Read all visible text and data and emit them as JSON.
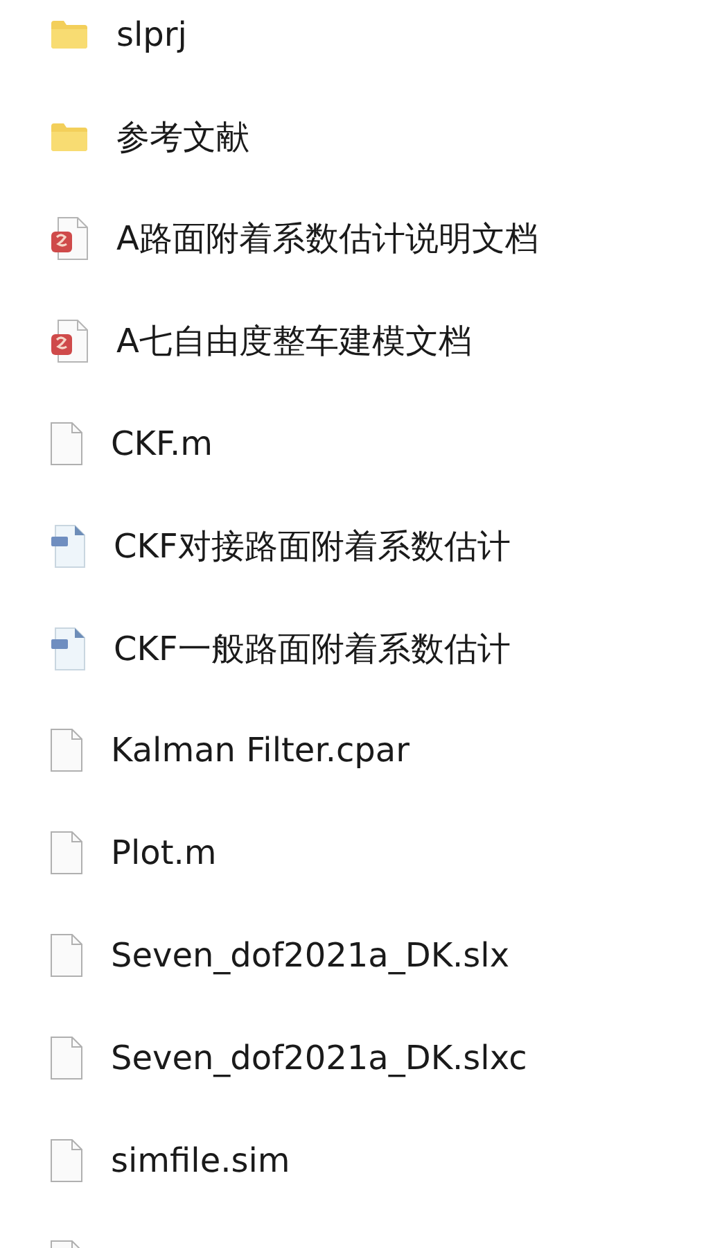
{
  "files": [
    {
      "kind": "folder",
      "name": "slprj"
    },
    {
      "kind": "folder",
      "name": "参考文献"
    },
    {
      "kind": "pdf",
      "name": "A路面附着系数估计说明文档"
    },
    {
      "kind": "pdf",
      "name": "A七自由度整车建模文档"
    },
    {
      "kind": "blank",
      "name": "CKF.m"
    },
    {
      "kind": "image",
      "name": "CKF对接路面附着系数估计"
    },
    {
      "kind": "image",
      "name": "CKF一般路面附着系数估计"
    },
    {
      "kind": "blank",
      "name": "Kalman Filter.cpar"
    },
    {
      "kind": "blank",
      "name": "Plot.m"
    },
    {
      "kind": "blank",
      "name": "Seven_dof2021a_DK.slx"
    },
    {
      "kind": "blank",
      "name": "Seven_dof2021a_DK.slxc"
    },
    {
      "kind": "blank",
      "name": "simfile.sim"
    },
    {
      "kind": "blank"
    }
  ]
}
